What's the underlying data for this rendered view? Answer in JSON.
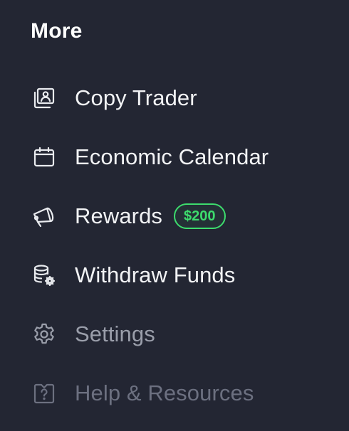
{
  "section": {
    "title": "More"
  },
  "menu": {
    "items": [
      {
        "label": "Copy Trader",
        "icon": "copy-trader-icon"
      },
      {
        "label": "Economic Calendar",
        "icon": "calendar-icon"
      },
      {
        "label": "Rewards",
        "icon": "megaphone-icon",
        "badge": "$200"
      },
      {
        "label": "Withdraw Funds",
        "icon": "coins-gear-icon"
      },
      {
        "label": "Settings",
        "icon": "gear-icon"
      },
      {
        "label": "Help & Resources",
        "icon": "help-icon"
      }
    ]
  },
  "colors": {
    "background": "#232633",
    "text_primary": "#f2f3f5",
    "text_dim": "#9a9eaa",
    "text_dimmer": "#6c7080",
    "badge_green": "#3ddc6d"
  }
}
